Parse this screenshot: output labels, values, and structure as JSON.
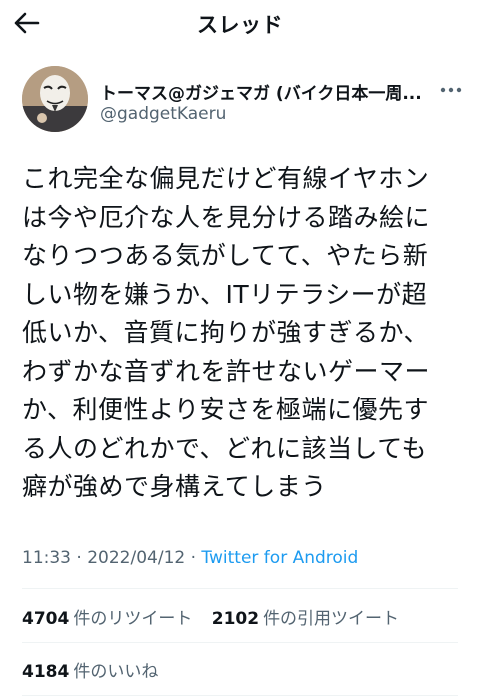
{
  "header": {
    "title": "スレッド",
    "back_icon": "arrow-left-icon"
  },
  "tweet": {
    "author_name": "トーマス@ガジェマガ (バイク日本一周...",
    "author_handle": "@gadgetKaeru",
    "text": "これ完全な偏見だけど有線イヤホン\nは今や厄介な人を見分ける踏み絵に\nなりつつある気がしてて、やたら新\nしい物を嫌うか、ITリテラシーが超\n低いか、音質に拘りが強すぎるか、\nわずかな音ずれを許せないゲーマー\nか、利便性より安さを極端に優先す\nる人のどれかで、どれに該当しても\n癖が強めで身構えてしまう",
    "time": "11:33",
    "date": "2022/04/12",
    "client": "Twitter for Android",
    "more_icon": "more-horizontal-icon"
  },
  "stats": {
    "retweets": "4704",
    "retweets_label": "件のリツイート",
    "quotes": "2102",
    "quotes_label": "件の引用ツイート",
    "likes": "4184",
    "likes_label": "件のいいね"
  }
}
